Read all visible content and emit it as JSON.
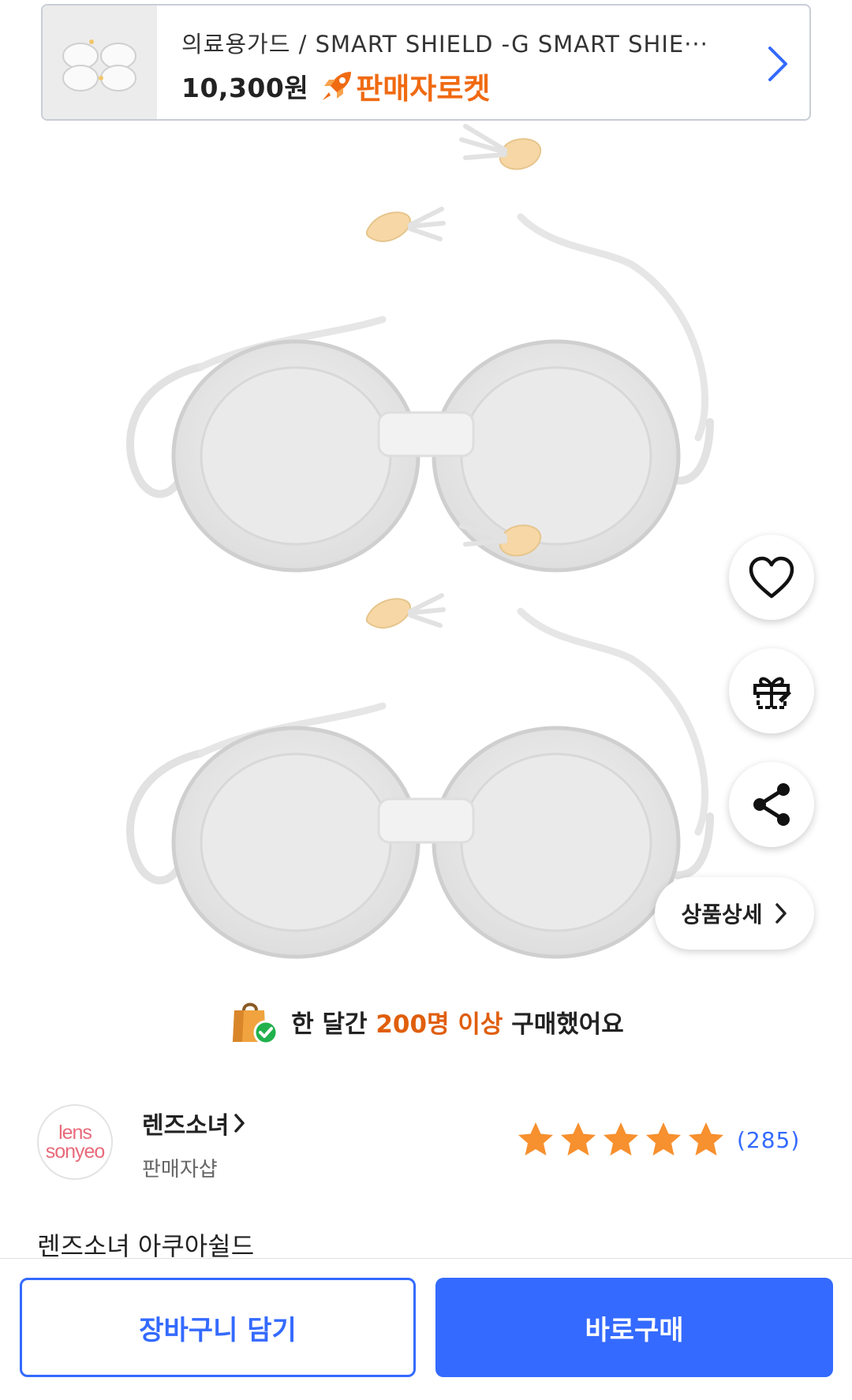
{
  "banner": {
    "title": "의료용가드 / SMART SHIELD -G SMART SHIE···",
    "price": "10,300원",
    "rocket_label": "판매자로켓",
    "thumbnail_icon": "goggles-thumbnail",
    "chevron_icon": "chevron-right-icon"
  },
  "product_image": {
    "description_icon": "eye-shield-goggles-photo"
  },
  "actions": {
    "favorite_icon": "heart-icon",
    "gift_icon": "gift-icon",
    "share_icon": "share-icon",
    "detail_label": "상품상세"
  },
  "purchase_notice": {
    "prefix": "한 달간",
    "highlight": "200명 이상",
    "suffix": "구매했어요"
  },
  "seller": {
    "logo_line1": "lens",
    "logo_line2": "sonyeo",
    "name": "렌즈소녀",
    "type": "판매자샵"
  },
  "rating": {
    "stars": 5,
    "max_stars": 5,
    "count": "(285)"
  },
  "product": {
    "name": "렌즈소녀 아쿠아쉴드"
  },
  "bottom": {
    "cart_label": "장바구니 담기",
    "buy_label": "바로구매"
  },
  "colors": {
    "accent": "#346aff",
    "rocket": "#f06a12",
    "highlight": "#e05e0c",
    "star": "#f7902e"
  }
}
